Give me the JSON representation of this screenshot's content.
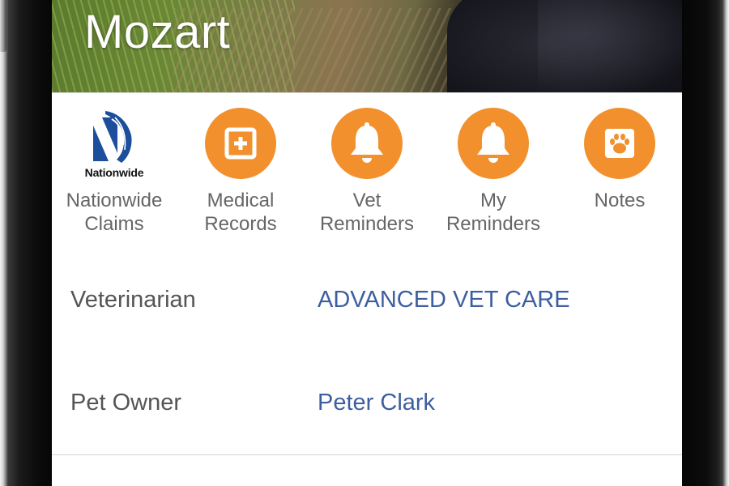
{
  "pet": {
    "name": "Mozart"
  },
  "actions": [
    {
      "label": "Nationwide\nClaims",
      "icon": "nationwide-logo",
      "logo_text": "Nationwide"
    },
    {
      "label": "Medical\nRecords",
      "icon": "medical-cross-icon"
    },
    {
      "label": "Vet\nReminders",
      "icon": "bell-icon"
    },
    {
      "label": "My\nReminders",
      "icon": "bell-icon"
    },
    {
      "label": "Notes",
      "icon": "paw-icon"
    }
  ],
  "details": [
    {
      "label": "Veterinarian",
      "value": "ADVANCED VET CARE"
    },
    {
      "label": "Pet Owner",
      "value": "Peter Clark"
    }
  ],
  "colors": {
    "accent": "#f2902d",
    "link": "#3d5fa0",
    "nationwide_blue": "#1c4e9c"
  }
}
